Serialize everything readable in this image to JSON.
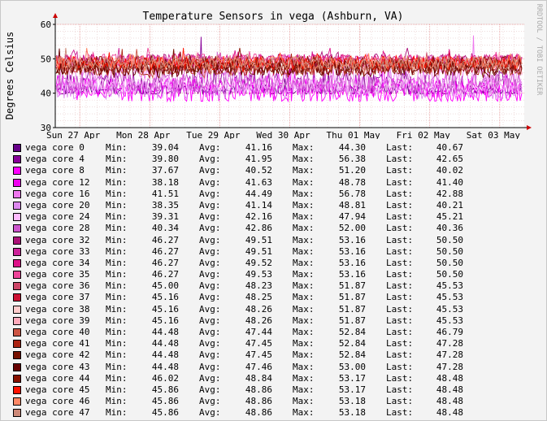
{
  "chart_data": {
    "type": "line",
    "title": "Temperature Sensors in vega (Ashburn, VA)",
    "ylabel": "Degrees Celsius",
    "xlabel": "",
    "side_label": "RRDTOOL / TOBI OETIKER",
    "ylim": [
      30,
      60
    ],
    "yticks": [
      "30",
      "40",
      "50",
      "60"
    ],
    "ytick_values": [
      30,
      40,
      50,
      60
    ],
    "xticks": [
      "Sun 27 Apr",
      "Mon 28 Apr",
      "Tue 29 Apr",
      "Wed 30 Apr",
      "Thu 01 May",
      "Fri 02 May",
      "Sat 03 May"
    ],
    "grid": true,
    "legend_placement": "bottom",
    "stat_labels": {
      "min": "Min:",
      "avg": "Avg:",
      "max": "Max:",
      "last": "Last:"
    },
    "series": [
      {
        "name": "vega core 0",
        "color": "#660088",
        "min": "39.04",
        "avg": "41.16",
        "max": "44.30",
        "last": "40.67"
      },
      {
        "name": "vega core 4",
        "color": "#880099",
        "min": "39.80",
        "avg": "41.95",
        "max": "56.38",
        "last": "42.65"
      },
      {
        "name": "vega core 8",
        "color": "#ff00ff",
        "min": "37.67",
        "avg": "40.52",
        "max": "51.20",
        "last": "40.02"
      },
      {
        "name": "vega core 12",
        "color": "#ee00ee",
        "min": "38.18",
        "avg": "41.63",
        "max": "48.78",
        "last": "41.40"
      },
      {
        "name": "vega core 16",
        "color": "#ee77ee",
        "min": "41.51",
        "avg": "44.49",
        "max": "56.78",
        "last": "42.88"
      },
      {
        "name": "vega core 20",
        "color": "#dd88ee",
        "min": "38.35",
        "avg": "41.14",
        "max": "48.81",
        "last": "40.21"
      },
      {
        "name": "vega core 24",
        "color": "#ffbbff",
        "min": "39.31",
        "avg": "42.16",
        "max": "47.94",
        "last": "45.21"
      },
      {
        "name": "vega core 28",
        "color": "#cc55cc",
        "min": "40.34",
        "avg": "42.86",
        "max": "52.00",
        "last": "40.36"
      },
      {
        "name": "vega core 32",
        "color": "#aa1177",
        "min": "46.27",
        "avg": "49.51",
        "max": "53.16",
        "last": "50.50"
      },
      {
        "name": "vega core 33",
        "color": "#cc2299",
        "min": "46.27",
        "avg": "49.51",
        "max": "53.16",
        "last": "50.50"
      },
      {
        "name": "vega core 34",
        "color": "#dd1188",
        "min": "46.27",
        "avg": "49.52",
        "max": "53.16",
        "last": "50.50"
      },
      {
        "name": "vega core 35",
        "color": "#ee4499",
        "min": "46.27",
        "avg": "49.53",
        "max": "53.16",
        "last": "50.50"
      },
      {
        "name": "vega core 36",
        "color": "#cc4466",
        "min": "45.00",
        "avg": "48.23",
        "max": "51.87",
        "last": "45.53"
      },
      {
        "name": "vega core 37",
        "color": "#cc1133",
        "min": "45.16",
        "avg": "48.25",
        "max": "51.87",
        "last": "45.53"
      },
      {
        "name": "vega core 38",
        "color": "#ffcccc",
        "min": "45.16",
        "avg": "48.26",
        "max": "51.87",
        "last": "45.53"
      },
      {
        "name": "vega core 39",
        "color": "#ffaabb",
        "min": "45.16",
        "avg": "48.26",
        "max": "51.87",
        "last": "45.53"
      },
      {
        "name": "vega core 40",
        "color": "#cc5544",
        "min": "44.48",
        "avg": "47.44",
        "max": "52.84",
        "last": "46.79"
      },
      {
        "name": "vega core 41",
        "color": "#aa2211",
        "min": "44.48",
        "avg": "47.45",
        "max": "52.84",
        "last": "47.28"
      },
      {
        "name": "vega core 42",
        "color": "#771100",
        "min": "44.48",
        "avg": "47.45",
        "max": "52.84",
        "last": "47.28"
      },
      {
        "name": "vega core 43",
        "color": "#660000",
        "min": "44.48",
        "avg": "47.46",
        "max": "53.00",
        "last": "47.28"
      },
      {
        "name": "vega core 44",
        "color": "#881100",
        "min": "46.02",
        "avg": "48.84",
        "max": "53.17",
        "last": "48.48"
      },
      {
        "name": "vega core 45",
        "color": "#ff1100",
        "min": "45.86",
        "avg": "48.86",
        "max": "53.17",
        "last": "48.48"
      },
      {
        "name": "vega core 46",
        "color": "#ff8866",
        "min": "45.86",
        "avg": "48.86",
        "max": "53.18",
        "last": "48.48"
      },
      {
        "name": "vega core 47",
        "color": "#cc8877",
        "min": "45.86",
        "avg": "48.86",
        "max": "53.18",
        "last": "48.48"
      }
    ]
  }
}
